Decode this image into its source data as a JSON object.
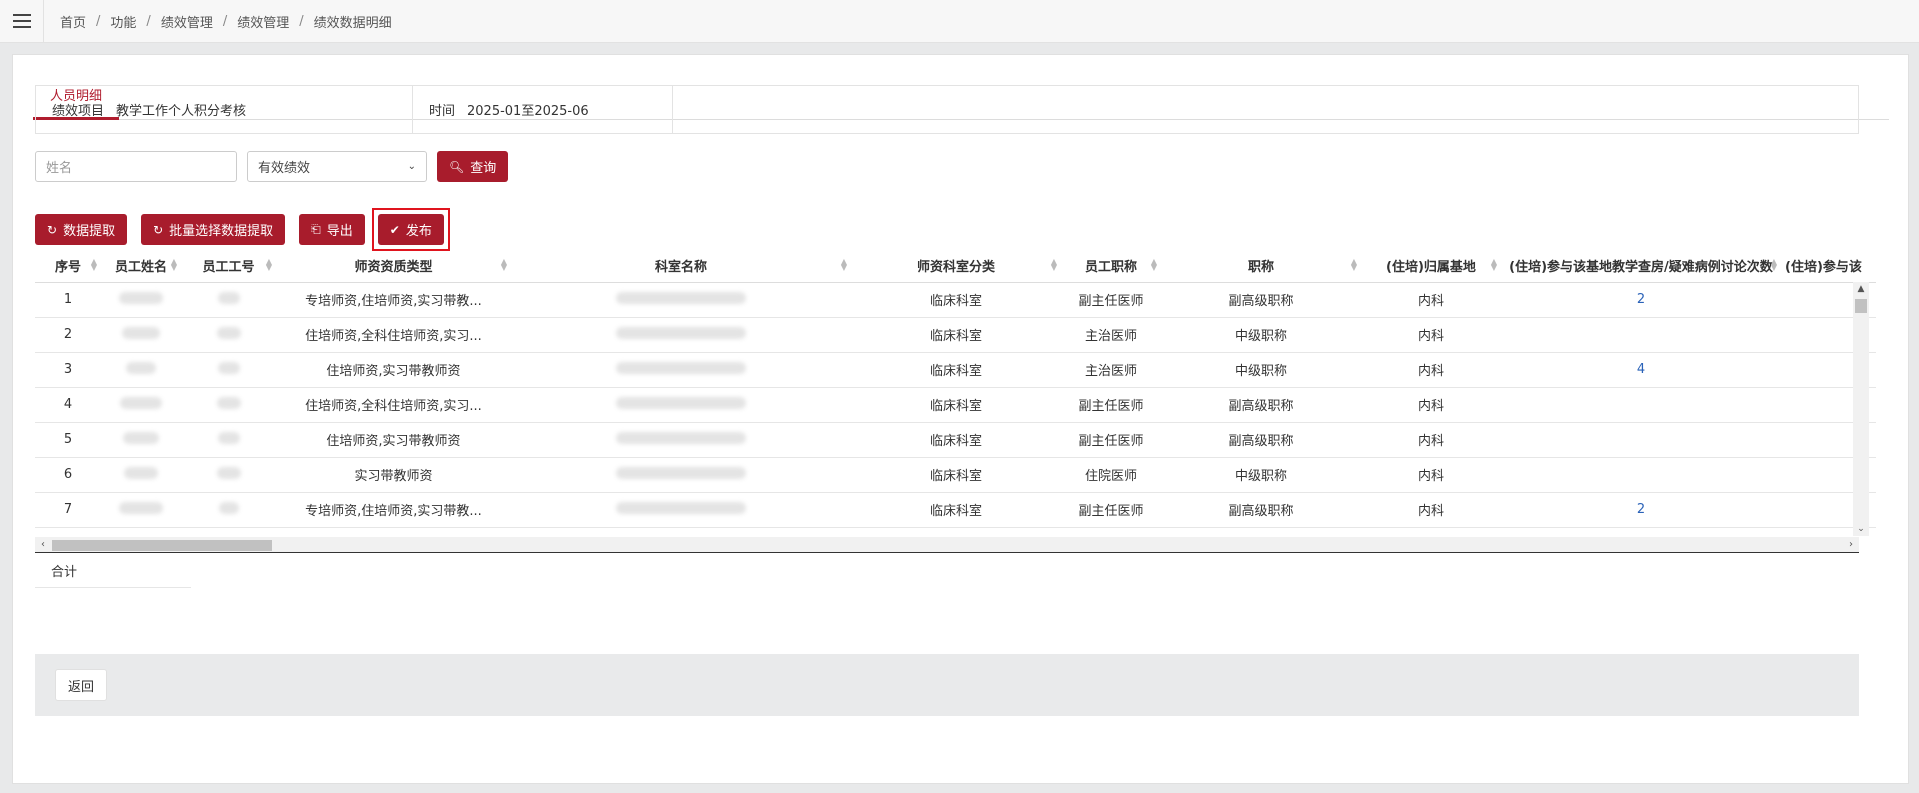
{
  "breadcrumb": [
    "首页",
    "功能",
    "绩效管理",
    "绩效管理",
    "绩效数据明细"
  ],
  "tab": {
    "label": "人员明细"
  },
  "info": {
    "project_label": "绩效项目",
    "project_value": "教学工作个人积分考核",
    "time_label": "时间",
    "time_value": "2025-01至2025-06"
  },
  "filters": {
    "name_placeholder": "姓名",
    "status_selected": "有效绩效",
    "query_label": "查询"
  },
  "actions": {
    "extract_label": "数据提取",
    "batch_extract_label": "批量选择数据提取",
    "export_label": "导出",
    "publish_label": "发布"
  },
  "table": {
    "columns": [
      "序号",
      "员工姓名",
      "员工工号",
      "师资资质类型",
      "科室名称",
      "师资科室分类",
      "员工职称",
      "职称",
      "(住培)归属基地",
      "(住培)参与该基地教学查房/疑难病例讨论次数",
      "(住培)参与该"
    ],
    "rows": [
      {
        "no": "1",
        "qual": "专培师资,住培师资,实习带教...",
        "dept_type": "临床科室",
        "title": "副主任医师",
        "level": "副高级职称",
        "base": "内科",
        "count": "2"
      },
      {
        "no": "2",
        "qual": "住培师资,全科住培师资,实习...",
        "dept_type": "临床科室",
        "title": "主治医师",
        "level": "中级职称",
        "base": "内科",
        "count": ""
      },
      {
        "no": "3",
        "qual": "住培师资,实习带教师资",
        "dept_type": "临床科室",
        "title": "主治医师",
        "level": "中级职称",
        "base": "内科",
        "count": "4"
      },
      {
        "no": "4",
        "qual": "住培师资,全科住培师资,实习...",
        "dept_type": "临床科室",
        "title": "副主任医师",
        "level": "副高级职称",
        "base": "内科",
        "count": ""
      },
      {
        "no": "5",
        "qual": "住培师资,实习带教师资",
        "dept_type": "临床科室",
        "title": "副主任医师",
        "level": "副高级职称",
        "base": "内科",
        "count": ""
      },
      {
        "no": "6",
        "qual": "实习带教师资",
        "dept_type": "临床科室",
        "title": "住院医师",
        "level": "中级职称",
        "base": "内科",
        "count": ""
      },
      {
        "no": "7",
        "qual": "专培师资,住培师资,实习带教...",
        "dept_type": "临床科室",
        "title": "副主任医师",
        "level": "副高级职称",
        "base": "内科",
        "count": "2"
      }
    ]
  },
  "total": {
    "label": "合计"
  },
  "footer": {
    "back_label": "返回"
  }
}
